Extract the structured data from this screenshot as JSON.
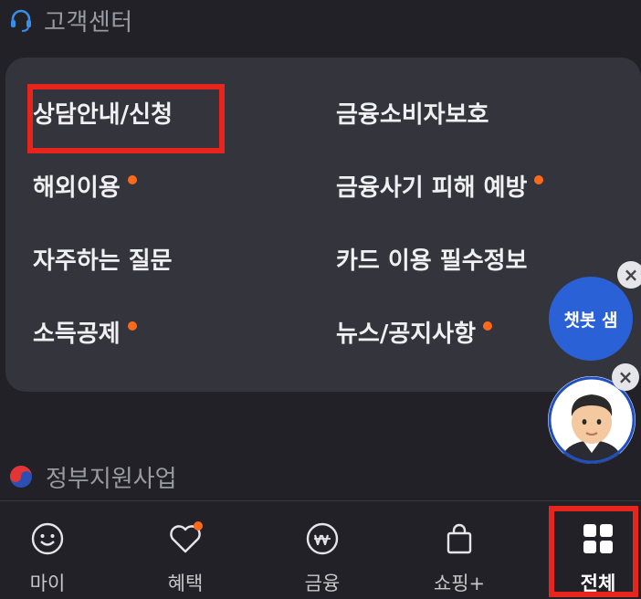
{
  "customer_center": {
    "title": "고객센터",
    "links": [
      {
        "label": "상담안내/신청",
        "dot": false
      },
      {
        "label": "금융소비자보호",
        "dot": false
      },
      {
        "label": "해외이용",
        "dot": true
      },
      {
        "label": "금융사기 피해 예방",
        "dot": true
      },
      {
        "label": "자주하는 질문",
        "dot": false
      },
      {
        "label": "카드 이용 필수정보",
        "dot": false
      },
      {
        "label": "소득공제",
        "dot": true
      },
      {
        "label": "뉴스/공지사항",
        "dot": true
      }
    ]
  },
  "government_support": {
    "title": "정부지원사업"
  },
  "floating": {
    "chatbot_label": "챗봇 샘",
    "close_glyph": "×"
  },
  "bottom_nav": {
    "items": [
      {
        "label": "마이",
        "icon": "smiley-icon"
      },
      {
        "label": "혜택",
        "icon": "heart-icon",
        "badge": true
      },
      {
        "label": "금융",
        "icon": "won-coin-icon"
      },
      {
        "label": "쇼핑+",
        "icon": "shopping-bag-icon"
      },
      {
        "label": "전체",
        "icon": "grid-icon",
        "active": true
      }
    ]
  },
  "colors": {
    "background": "#212127",
    "card": "#34343c",
    "accent_dot": "#ff6a1a",
    "highlight": "#e8251c",
    "chatbot": "#2a61d6"
  }
}
